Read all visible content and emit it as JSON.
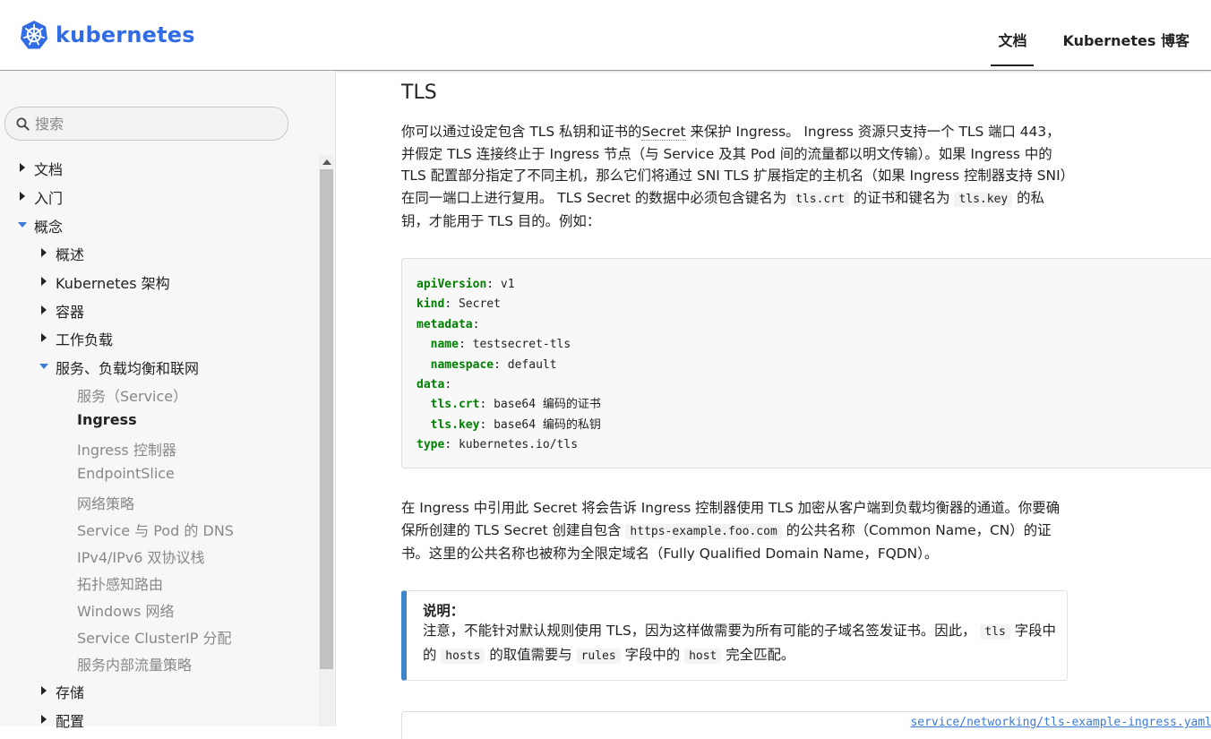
{
  "header": {
    "brand": "kubernetes",
    "nav": [
      {
        "label": "文档",
        "active": true
      },
      {
        "label": "Kubernetes 博客",
        "active": false
      }
    ]
  },
  "sidebar": {
    "search_placeholder": "搜索",
    "tree": [
      {
        "label": "文档",
        "state": "collapsed",
        "level": 0
      },
      {
        "label": "入门",
        "state": "collapsed",
        "level": 0
      },
      {
        "label": "概念",
        "state": "expanded",
        "level": 0
      },
      {
        "label": "概述",
        "state": "collapsed",
        "level": 1
      },
      {
        "label": "Kubernetes 架构",
        "state": "collapsed",
        "level": 1
      },
      {
        "label": "容器",
        "state": "collapsed",
        "level": 1
      },
      {
        "label": "工作负载",
        "state": "collapsed",
        "level": 1
      },
      {
        "label": "服务、负载均衡和联网",
        "state": "expanded",
        "level": 1
      },
      {
        "label": "存储",
        "state": "collapsed",
        "level": 1
      },
      {
        "label": "配置",
        "state": "collapsed",
        "level": 1
      }
    ],
    "leaves": [
      {
        "label": "服务（Service）"
      },
      {
        "label": "Ingress",
        "current": true
      },
      {
        "label": "Ingress 控制器"
      },
      {
        "label": "EndpointSlice"
      },
      {
        "label": "网络策略"
      },
      {
        "label": "Service 与 Pod 的 DNS"
      },
      {
        "label": "IPv4/IPv6 双协议栈"
      },
      {
        "label": "拓扑感知路由"
      },
      {
        "label": "Windows 网络"
      },
      {
        "label": "Service ClusterIP 分配"
      },
      {
        "label": "服务内部流量策略"
      }
    ]
  },
  "content": {
    "heading": "TLS",
    "p1": {
      "t1": "你可以通过设定包含 TLS 私钥和证书的",
      "link": "Secret",
      "t2": " 来保护 Ingress。 Ingress 资源只支持一个 TLS 端口 443，并假定 TLS 连接终止于 Ingress 节点（与 Service 及其 Pod 间的流量都以明文传输）。如果 Ingress 中的 TLS 配置部分指定了不同主机，那么它们将通过 SNI TLS 扩展指定的主机名（如果 Ingress 控制器支持 SNI）在同一端口上进行复用。 TLS Secret 的数据中必须包含键名为 ",
      "code1": "tls.crt",
      "t3": " 的证书和键名为 ",
      "code2": "tls.key",
      "t4": " 的私钥，才能用于 TLS 目的。例如："
    },
    "code_lines": [
      {
        "key": "apiVersion",
        "value": " v1",
        "indent": ""
      },
      {
        "key": "kind",
        "value": " Secret",
        "indent": ""
      },
      {
        "key": "metadata",
        "value": "",
        "indent": ""
      },
      {
        "key": "name",
        "value": " testsecret-tls",
        "indent": "  "
      },
      {
        "key": "namespace",
        "value": " default",
        "indent": "  "
      },
      {
        "key": "data",
        "value": "",
        "indent": ""
      },
      {
        "key": "tls.crt",
        "value": " base64 编码的证书",
        "indent": "  "
      },
      {
        "key": "tls.key",
        "value": " base64 编码的私钥",
        "indent": "  "
      },
      {
        "key": "type",
        "value": " kubernetes.io/tls",
        "indent": ""
      }
    ],
    "p2": {
      "t1": "在 Ingress 中引用此 Secret 将会告诉 Ingress 控制器使用 TLS 加密从客户端到负载均衡器的通道。你要确保所创建的 TLS Secret 创建自包含 ",
      "code1": "https-example.foo.com",
      "t2": " 的公共名称（Common Name，CN）的证书。这里的公共名称也被称为全限定域名（Fully Qualified Domain Name，FQDN）。"
    },
    "note": {
      "title": "说明：",
      "t1": "注意，不能针对默认规则使用 TLS，因为这样做需要为所有可能的子域名签发证书。因此， ",
      "code1": "tls",
      "t2": " 字段中的 ",
      "code2": "hosts",
      "t3": " 的取值需要与 ",
      "code3": "rules",
      "t4": " 字段中的 ",
      "code4": "host",
      "t5": " 完全匹配。"
    },
    "yaml_link": "service/networking/tls-example-ingress.yaml"
  }
}
